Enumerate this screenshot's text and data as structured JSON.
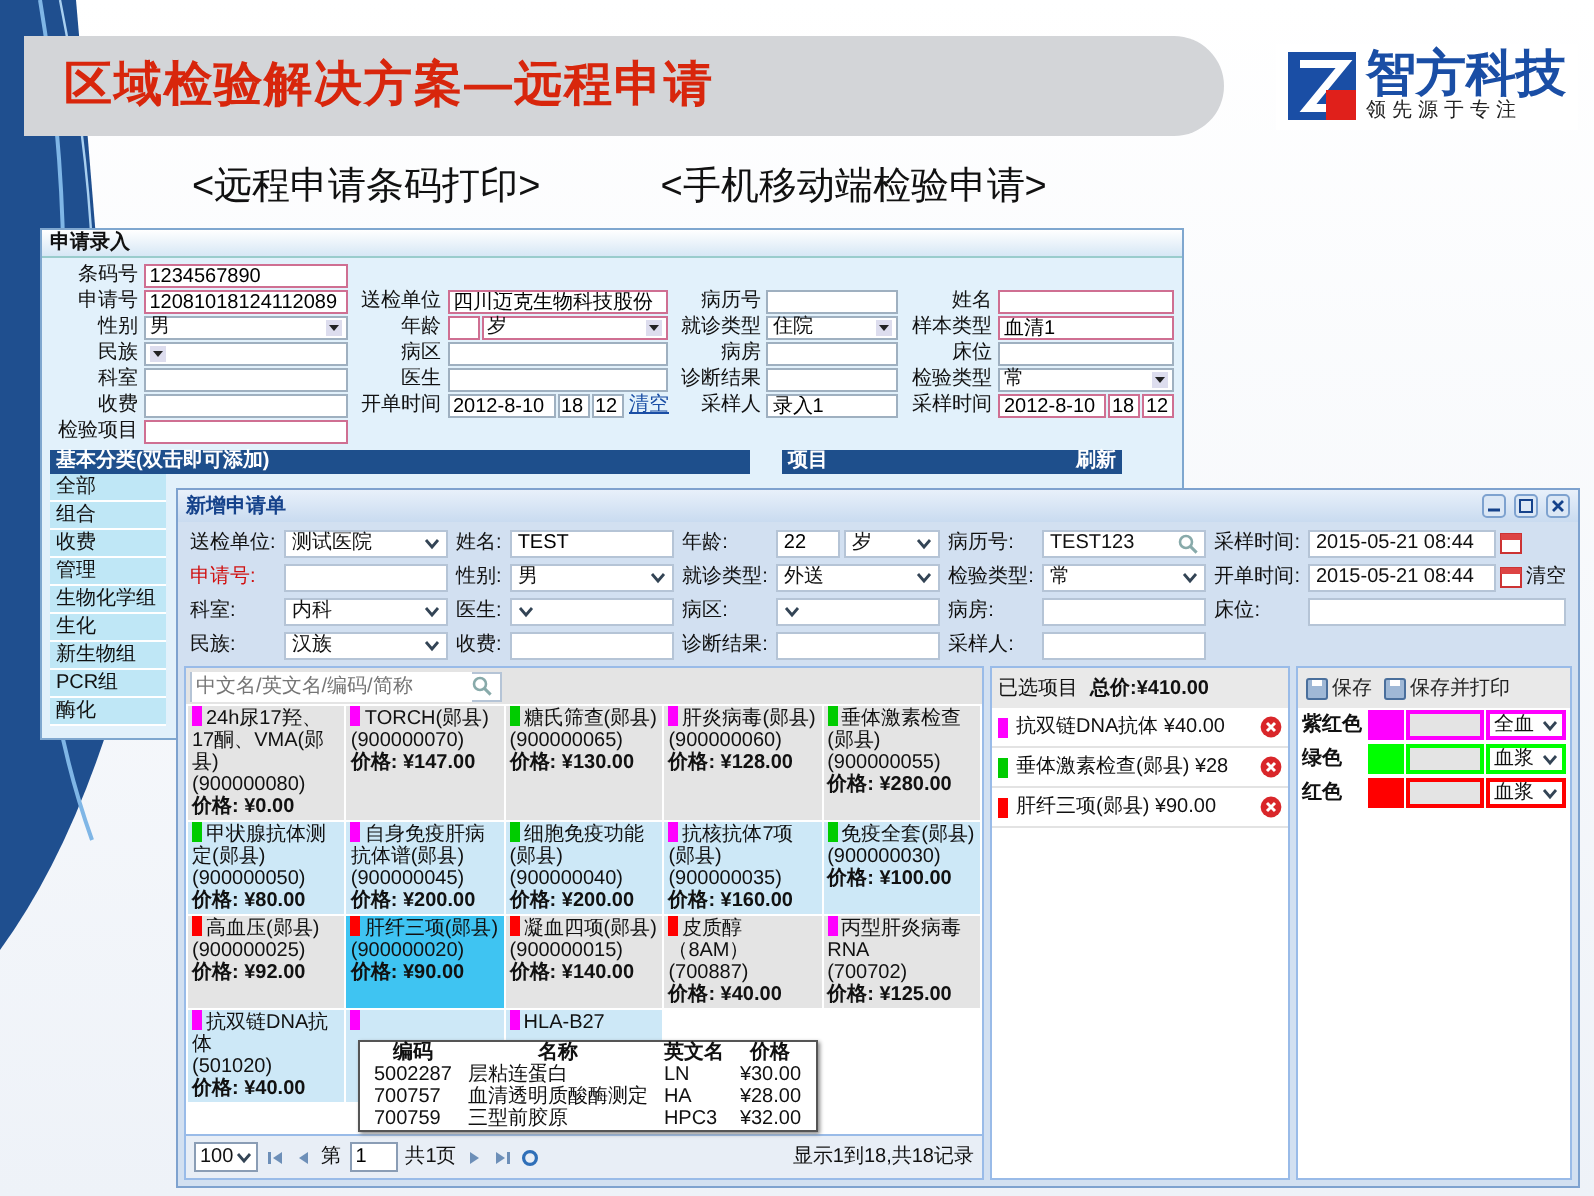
{
  "slide": {
    "title": "区域检验解决方案—远程申请",
    "logo": {
      "name": "智方科技",
      "tagline": "领先源于专注"
    },
    "subtitles": [
      "<远程申请条码打印>",
      "<手机移动端检验申请>"
    ]
  },
  "barcode_window": {
    "title": "申请录入",
    "form_rows": [
      [
        {
          "label": "条码号",
          "required": true,
          "inputs": [
            {
              "kind": "text",
              "value": "1234567890"
            }
          ]
        }
      ],
      [
        {
          "label": "申请号",
          "required": true,
          "inputs": [
            {
              "kind": "text",
              "value": "12081018124112089"
            }
          ]
        },
        {
          "label": "送检单位",
          "required": true,
          "inputs": [
            {
              "kind": "text",
              "value": "四川迈克生物科技股份"
            }
          ]
        },
        {
          "label": "病历号",
          "required": false,
          "inputs": [
            {
              "kind": "text"
            }
          ]
        },
        {
          "label": "姓名",
          "required": true,
          "inputs": [
            {
              "kind": "text"
            }
          ]
        }
      ],
      [
        {
          "label": "性别",
          "required": false,
          "inputs": [
            {
              "kind": "select",
              "value": "男"
            }
          ]
        },
        {
          "label": "年龄",
          "required": true,
          "inputs": [
            {
              "kind": "short"
            },
            {
              "kind": "select",
              "value": "岁"
            }
          ]
        },
        {
          "label": "就诊类型",
          "required": false,
          "inputs": [
            {
              "kind": "select",
              "value": "住院"
            }
          ]
        },
        {
          "label": "样本类型",
          "required": true,
          "inputs": [
            {
              "kind": "text",
              "value": "血清1"
            }
          ]
        }
      ],
      [
        {
          "label": "民族",
          "required": false,
          "inputs": [
            {
              "kind": "select"
            }
          ]
        },
        {
          "label": "病区",
          "required": false,
          "inputs": [
            {
              "kind": "text"
            }
          ]
        },
        {
          "label": "病房",
          "required": false,
          "inputs": [
            {
              "kind": "text"
            }
          ]
        },
        {
          "label": "床位",
          "required": false,
          "inputs": [
            {
              "kind": "text"
            }
          ]
        }
      ],
      [
        {
          "label": "科室",
          "required": false,
          "inputs": [
            {
              "kind": "text"
            }
          ]
        },
        {
          "label": "医生",
          "required": false,
          "inputs": [
            {
              "kind": "text"
            }
          ]
        },
        {
          "label": "诊断结果",
          "required": false,
          "inputs": [
            {
              "kind": "text"
            }
          ]
        },
        {
          "label": "检验类型",
          "required": false,
          "inputs": [
            {
              "kind": "select",
              "value": "常"
            }
          ]
        }
      ],
      [
        {
          "label": "收费",
          "required": false,
          "inputs": [
            {
              "kind": "text"
            }
          ]
        },
        {
          "label": "开单时间",
          "required": false,
          "inputs": [
            {
              "kind": "date",
              "value": "2012-8-10"
            },
            {
              "kind": "short",
              "value": "18"
            },
            {
              "kind": "short",
              "value": "12"
            }
          ],
          "link": "清空"
        },
        {
          "label": "采样人",
          "required": false,
          "inputs": [
            {
              "kind": "text",
              "value": "录入1"
            }
          ]
        },
        {
          "label": "采样时间",
          "required": true,
          "inputs": [
            {
              "kind": "date",
              "value": "2012-8-10"
            },
            {
              "kind": "short",
              "value": "18"
            },
            {
              "kind": "short",
              "value": "12"
            }
          ]
        }
      ],
      [
        {
          "label": "检验项目",
          "required": true,
          "inputs": [
            {
              "kind": "text"
            }
          ]
        }
      ]
    ],
    "category_panel": {
      "title": "基本分类(双击即可添加)",
      "categories": [
        "全部",
        "组合",
        "收费",
        "管理",
        "生物化学组",
        "生化",
        "新生物组",
        "PCR组",
        "酶化"
      ]
    },
    "item_panel": {
      "title": "项目",
      "action": "刷新"
    }
  },
  "request_window": {
    "title": "新增申请单",
    "form_rows": [
      [
        {
          "label": "送检单位:",
          "required": false,
          "inputs": [
            {
              "kind": "select",
              "value": "测试医院"
            }
          ]
        },
        {
          "label": "姓名:",
          "required": false,
          "inputs": [
            {
              "kind": "text",
              "value": "TEST"
            }
          ]
        },
        {
          "label": "年龄:",
          "required": false,
          "inputs": [
            {
              "kind": "text",
              "value": "22"
            },
            {
              "kind": "select",
              "value": "岁"
            }
          ]
        },
        {
          "label": "病历号:",
          "required": false,
          "inputs": [
            {
              "kind": "search",
              "value": "TEST123"
            }
          ]
        },
        {
          "label": "采样时间:",
          "required": false,
          "inputs": [
            {
              "kind": "date",
              "value": "2015-05-21 08:44"
            }
          ]
        }
      ],
      [
        {
          "label": "申请号:",
          "required": true,
          "inputs": [
            {
              "kind": "text"
            }
          ]
        },
        {
          "label": "性别:",
          "required": false,
          "inputs": [
            {
              "kind": "select",
              "value": "男"
            }
          ]
        },
        {
          "label": "就诊类型:",
          "required": false,
          "inputs": [
            {
              "kind": "select",
              "value": "外送"
            }
          ]
        },
        {
          "label": "检验类型:",
          "required": false,
          "inputs": [
            {
              "kind": "select",
              "value": "常"
            }
          ]
        },
        {
          "label": "开单时间:",
          "required": false,
          "inputs": [
            {
              "kind": "date",
              "value": "2015-05-21 08:44"
            }
          ],
          "link": "清空"
        }
      ],
      [
        {
          "label": "科室:",
          "required": false,
          "inputs": [
            {
              "kind": "select",
              "value": "内科"
            }
          ]
        },
        {
          "label": "医生:",
          "required": false,
          "inputs": [
            {
              "kind": "select"
            }
          ]
        },
        {
          "label": "病区:",
          "required": false,
          "inputs": [
            {
              "kind": "select"
            }
          ]
        },
        {
          "label": "病房:",
          "required": false,
          "inputs": [
            {
              "kind": "text"
            }
          ]
        },
        {
          "label": "床位:",
          "required": false,
          "inputs": [
            {
              "kind": "text"
            }
          ]
        }
      ],
      [
        {
          "label": "民族:",
          "required": false,
          "inputs": [
            {
              "kind": "select",
              "value": "汉族"
            }
          ]
        },
        {
          "label": "收费:",
          "required": false,
          "inputs": [
            {
              "kind": "text"
            }
          ]
        },
        {
          "label": "诊断结果:",
          "required": false,
          "inputs": [
            {
              "kind": "text"
            }
          ]
        },
        {
          "label": "采样人:",
          "required": false,
          "inputs": [
            {
              "kind": "text"
            }
          ]
        }
      ]
    ],
    "search": {
      "placeholder": "中文名/英文名/编码/简称"
    },
    "tests": [
      {
        "name": "24h尿17羟、17酮、VMA(郧县)",
        "code": "(900000080)",
        "price": "价格: ¥0.00",
        "color": "#ff00ff",
        "selected": false
      },
      {
        "name": "TORCH(郧县)",
        "code": "(900000070)",
        "price": "价格: ¥147.00",
        "color": "#ff00ff",
        "selected": false
      },
      {
        "name": "糖氏筛查(郧县)",
        "code": "(900000065)",
        "price": "价格: ¥130.00",
        "color": "#00cc00",
        "selected": false
      },
      {
        "name": "肝炎病毒(郧县)",
        "code": "(900000060)",
        "price": "价格: ¥128.00",
        "color": "#ff00ff",
        "selected": false
      },
      {
        "name": "垂体激素检查(郧县)",
        "code": "(900000055)",
        "price": "价格: ¥280.00",
        "color": "#00cc00",
        "selected": false
      },
      {
        "name": "甲状腺抗体测定(郧县)",
        "code": "(900000050)",
        "price": "价格: ¥80.00",
        "color": "#00cc00",
        "selected": false
      },
      {
        "name": "自身免疫肝病抗体谱(郧县)",
        "code": "(900000045)",
        "price": "价格: ¥200.00",
        "color": "#ff00ff",
        "selected": false
      },
      {
        "name": "细胞免疫功能(郧县)",
        "code": "(900000040)",
        "price": "价格: ¥200.00",
        "color": "#00cc00",
        "selected": false
      },
      {
        "name": "抗核抗体7项(郧县)",
        "code": "(900000035)",
        "price": "价格: ¥160.00",
        "color": "#ff00ff",
        "selected": false
      },
      {
        "name": "免疫全套(郧县)",
        "code": "(900000030)",
        "price": "价格: ¥100.00",
        "color": "#00cc00",
        "selected": false
      },
      {
        "name": "高血压(郧县)",
        "code": "(900000025)",
        "price": "价格: ¥92.00",
        "color": "#ff0000",
        "selected": false
      },
      {
        "name": "肝纤三项(郧县)",
        "code": "(900000020)",
        "price": "价格: ¥90.00",
        "color": "#ff0000",
        "selected": true
      },
      {
        "name": "凝血四项(郧县)",
        "code": "(900000015)",
        "price": "价格: ¥140.00",
        "color": "#ff0000",
        "selected": false
      },
      {
        "name": "皮质醇（8AM）",
        "code": "(700887)",
        "price": "价格: ¥40.00",
        "color": "#ff0000",
        "selected": false
      },
      {
        "name": "丙型肝炎病毒RNA",
        "code": "(700702)",
        "price": "价格: ¥125.00",
        "color": "#ff00ff",
        "selected": false
      },
      {
        "name": "抗双链DNA抗体",
        "code": "(501020)",
        "price": "价格: ¥40.00",
        "color": "#ff00ff",
        "selected": false
      },
      {
        "color": "#ff00ff",
        "selected": false
      },
      {
        "name": "HLA-B27",
        "color": "#ff00ff",
        "selected": false
      }
    ],
    "popup": {
      "columns": [
        "编码",
        "名称",
        "英文名",
        "价格"
      ],
      "rows": [
        [
          "5002287",
          "层粘连蛋白",
          "LN",
          "¥30.00"
        ],
        [
          "700757",
          "血清透明质酸酶测定",
          "HA",
          "¥28.00"
        ],
        [
          "700759",
          "三型前胶原",
          "HPC3",
          "¥32.00"
        ]
      ]
    },
    "pager": {
      "page_size": "100",
      "page_prefix": "第",
      "page": "1",
      "page_total": "共1页",
      "summary": "显示1到18,共18记录"
    },
    "selected_panel": {
      "title": "已选项目",
      "total": "总价:¥410.00",
      "items": [
        {
          "text": "抗双链DNA抗体 ¥40.00",
          "color": "#ff00ff"
        },
        {
          "text": "垂体激素检查(郧县) ¥28",
          "color": "#00cc00"
        },
        {
          "text": "肝纤三项(郧县) ¥90.00",
          "color": "#ff0000"
        }
      ]
    },
    "tube_panel": {
      "buttons": [
        "保存",
        "保存并打印"
      ],
      "tubes": [
        {
          "label": "紫红色",
          "color": "#ff00ff",
          "sample": "全血"
        },
        {
          "label": "绿色",
          "color": "#00ff00",
          "sample": "血浆"
        },
        {
          "label": "红色",
          "color": "#ff0000",
          "sample": "血浆"
        }
      ]
    }
  }
}
